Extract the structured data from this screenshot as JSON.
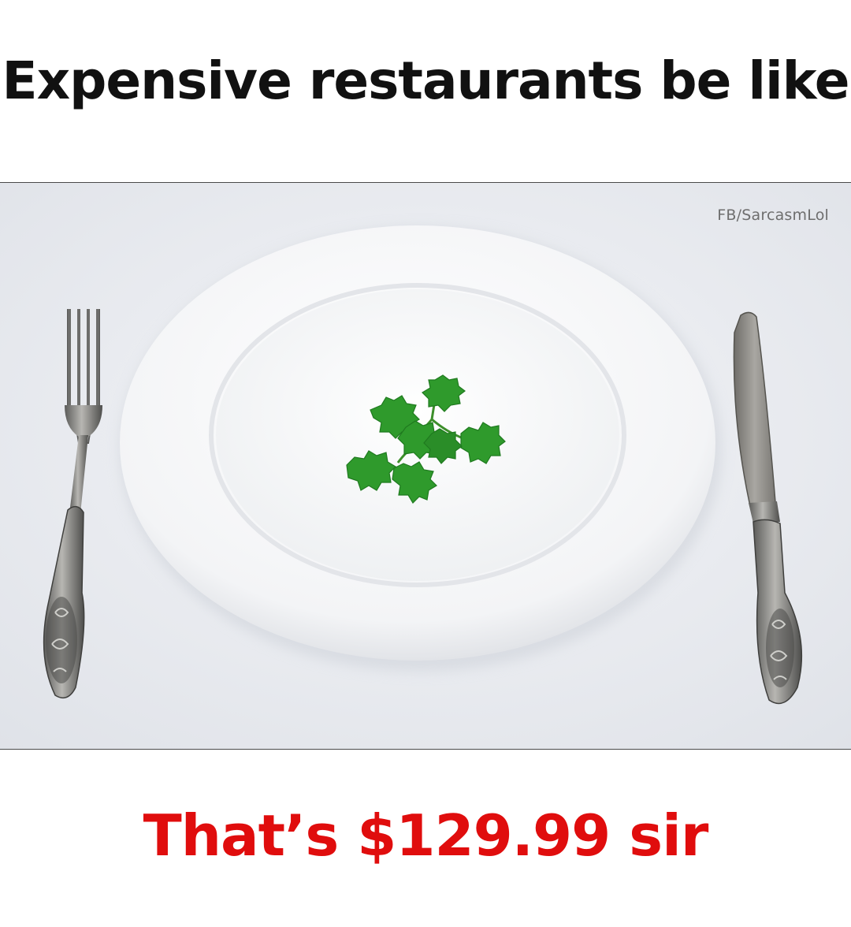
{
  "meme": {
    "headline": "Expensive restaurants be like",
    "caption": "That’s $129.99 sir",
    "watermark": "FB/SarcasmLol"
  },
  "colors": {
    "headline": "#111111",
    "caption": "#e00d0d",
    "tablecloth": "#edeff4",
    "plate": "#f7f8fa",
    "garnish": "#2f9a2c",
    "cutlery": "#8a8a88"
  },
  "icons": {
    "fork": "fork-icon",
    "knife": "knife-icon",
    "garnish": "parsley-garnish"
  }
}
